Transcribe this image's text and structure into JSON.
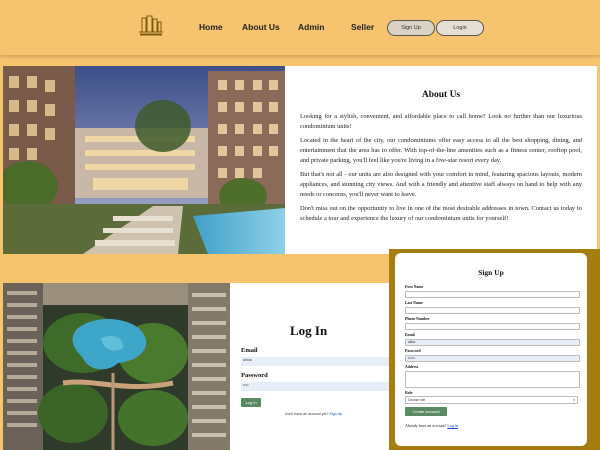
{
  "header": {
    "logo_icon": "building-logo-icon",
    "nav": [
      "Home",
      "About Us",
      "Admin",
      "Seller"
    ],
    "signup_label": "Sign Up",
    "login_label": "Login",
    "accent": "#f6c36e"
  },
  "about": {
    "title": "About Us",
    "paragraphs": [
      "Looking for a stylish, convenient, and affordable place to call home? Look no further than our luxurious condominium units!",
      "Located in the heart of the city, our condominiums offer easy access to all the best shopping, dining, and entertainment that the area has to offer. With top-of-the-line amenities such as a fitness center, rooftop pool, and private parking, you'll feel like you're living in a five-star resort every day.",
      "But that's not all - our units are also designed with your comfort in mind, featuring spacious layouts, modern appliances, and stunning city views. And with a friendly and attentive staff always on hand to help with any needs or concerns, you'll never want to leave.",
      "Don't miss out on the opportunity to live in one of the most desirable addresses in town. Contact us today to schedule a tour and experience the luxury of our condominium units for yourself!"
    ]
  },
  "login": {
    "title": "Log In",
    "email_label": "Email",
    "email_value": "abba",
    "password_label": "Password",
    "password_value": "••••",
    "button_label": "Log In",
    "footer_text": "Don't have an account yet?",
    "footer_link": "Sign Up"
  },
  "signup": {
    "title": "Sign Up",
    "first_name_label": "First Name",
    "last_name_label": "Last Name",
    "phone_label": "Phone Number",
    "email_label": "Email",
    "email_value": "abba",
    "password_label": "Password",
    "password_value": "••••••",
    "address_label": "Address",
    "role_label": "Role",
    "role_value": "Choose role",
    "button_label": "Create Account",
    "footer_text": "Already have an account?",
    "footer_link": "Log in"
  }
}
